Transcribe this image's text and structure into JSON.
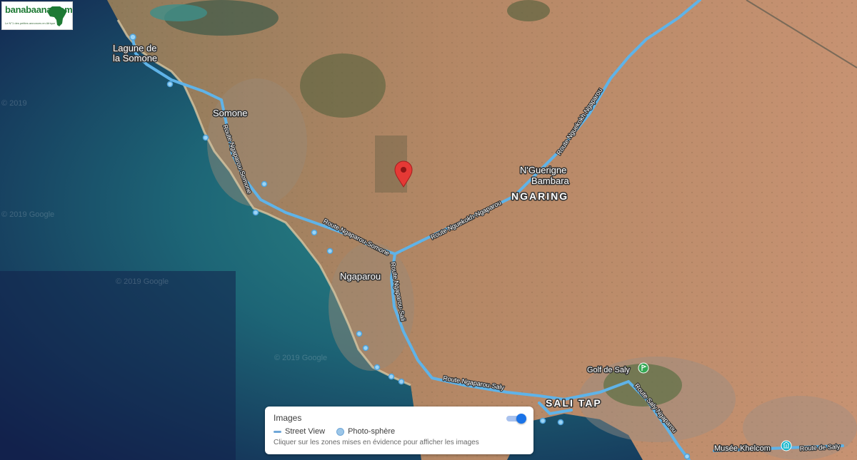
{
  "logo": {
    "text": "banabaana.com",
    "subtitle": "Le N°1 des petites annonces en Afrique"
  },
  "map": {
    "places": {
      "lagune_line1": "Lagune de",
      "lagune_line2": "la Somone",
      "somone": "Somone",
      "nguerigne_line1": "N'Guerigne",
      "nguerigne_line2": "Bambara",
      "ngaring": "NGARING",
      "ngaparou": "Ngaparou",
      "sali_tap": "SALI TAP"
    },
    "roads": {
      "route_ngaparou_somone_1": "Route Ngaparou-Somone",
      "route_ngaparou_somone_2": "Route Ngaparou-Somone",
      "route_nguekokh_ngaparou": "Route Nguekokh-Ngaparou",
      "route_nguekokh_ngaparou_2": "Route Nguekokh-Ngaparou",
      "route_ngaparou_saly": "Route Ngaparou-Saly",
      "route_ngaparou_sali": "Route Ngaparou-Sali",
      "route_saly_ngaparou": "Route Saly-Ngaparou",
      "route_de_saly": "Route de Saly"
    },
    "pois": {
      "golf": "Golf de Saly",
      "musee": "Musée Khelcom"
    },
    "watermarks": [
      "© 2019 Google",
      "© 2019 Google",
      "© 2019 Google",
      "© 2019"
    ],
    "colors": {
      "street_view": "#5fb3e8",
      "pin": "#e53935",
      "land": "#c28a66",
      "ocean": "#1f6b6b",
      "deep": "#15204a"
    }
  },
  "layer_panel": {
    "title": "Images",
    "street_view": "Street View",
    "photo_sphere": "Photo-sphère",
    "hint": "Cliquer sur les zones mises en évidence pour afficher les images",
    "toggle_on": true
  }
}
